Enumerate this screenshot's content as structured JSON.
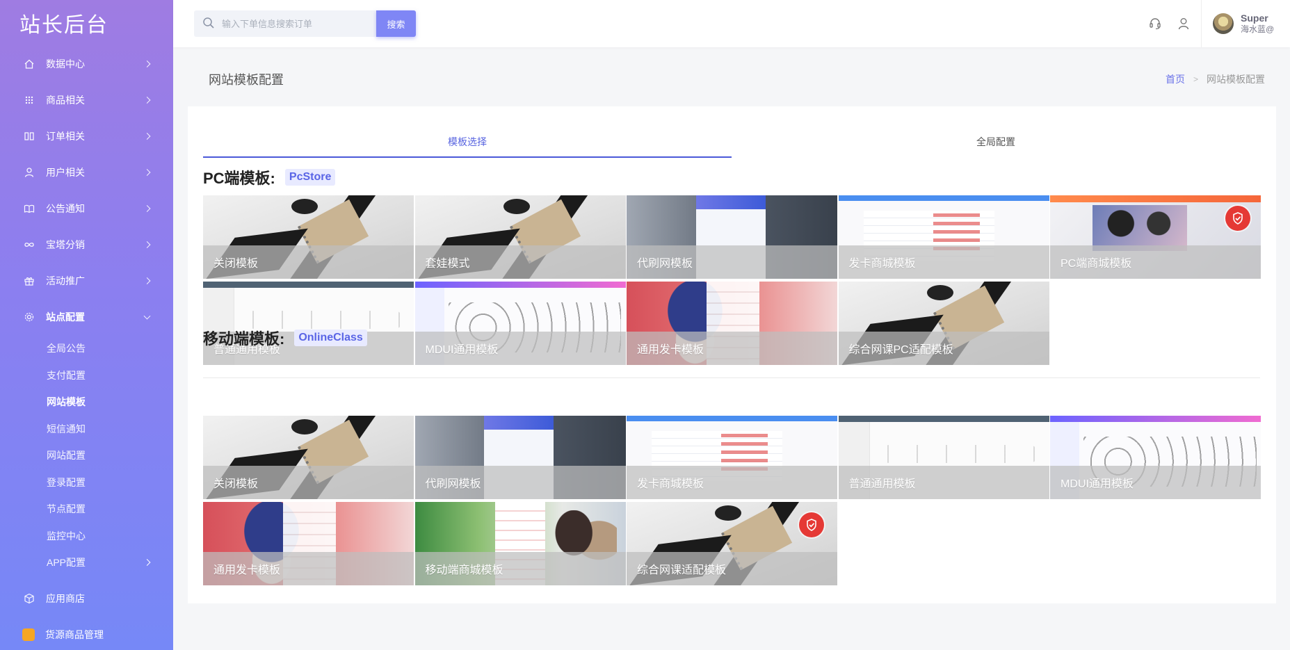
{
  "app": {
    "title": "站长后台"
  },
  "sidebar": {
    "items": [
      {
        "label": "数据中心",
        "icon": "home-icon"
      },
      {
        "label": "商品相关",
        "icon": "grid-icon"
      },
      {
        "label": "订单相关",
        "icon": "book-icon"
      },
      {
        "label": "用户相关",
        "icon": "user-icon"
      },
      {
        "label": "公告通知",
        "icon": "open-book-icon"
      },
      {
        "label": "宝塔分销",
        "icon": "infinity-icon"
      },
      {
        "label": "活动推广",
        "icon": "gift-icon"
      },
      {
        "label": "站点配置",
        "icon": "gear-icon"
      }
    ],
    "sub_items": [
      "全局公告",
      "支付配置",
      "网站模板",
      "短信通知",
      "网站配置",
      "登录配置",
      "节点配置",
      "监控中心",
      "APP配置"
    ],
    "bottom_items": [
      {
        "label": "应用商店",
        "icon": "cube-icon"
      },
      {
        "label": "货源商品管理",
        "icon": "bag-icon"
      }
    ]
  },
  "header": {
    "search_placeholder": "输入下单信息搜索订单",
    "search_button": "搜索",
    "user_name": "Super",
    "user_sub": "海水蓝@"
  },
  "page": {
    "title": "网站模板配置",
    "breadcrumb_home": "首页",
    "breadcrumb_current": "网站模板配置"
  },
  "tabs": [
    "模板选择",
    "全局配置"
  ],
  "pc": {
    "title": "PC端模板:",
    "badge": "PcStore",
    "templates": [
      "关闭模板",
      "套娃模式",
      "代刷网模板",
      "发卡商城模板",
      "PC端商城模板",
      "普通通用模板",
      "MDUI通用模板",
      "通用发卡模板",
      "综合网课PC适配模板"
    ]
  },
  "mobile": {
    "title": "移动端模板:",
    "badge": "OnlineClass",
    "templates": [
      "关闭模板",
      "代刷网模板",
      "发卡商城模板",
      "普通通用模板",
      "MDUI通用模板",
      "通用发卡模板",
      "移动端商城模板",
      "综合网课适配模板"
    ]
  },
  "colors": {
    "accent": "#7f86f5",
    "selected_badge": "#e53935"
  }
}
